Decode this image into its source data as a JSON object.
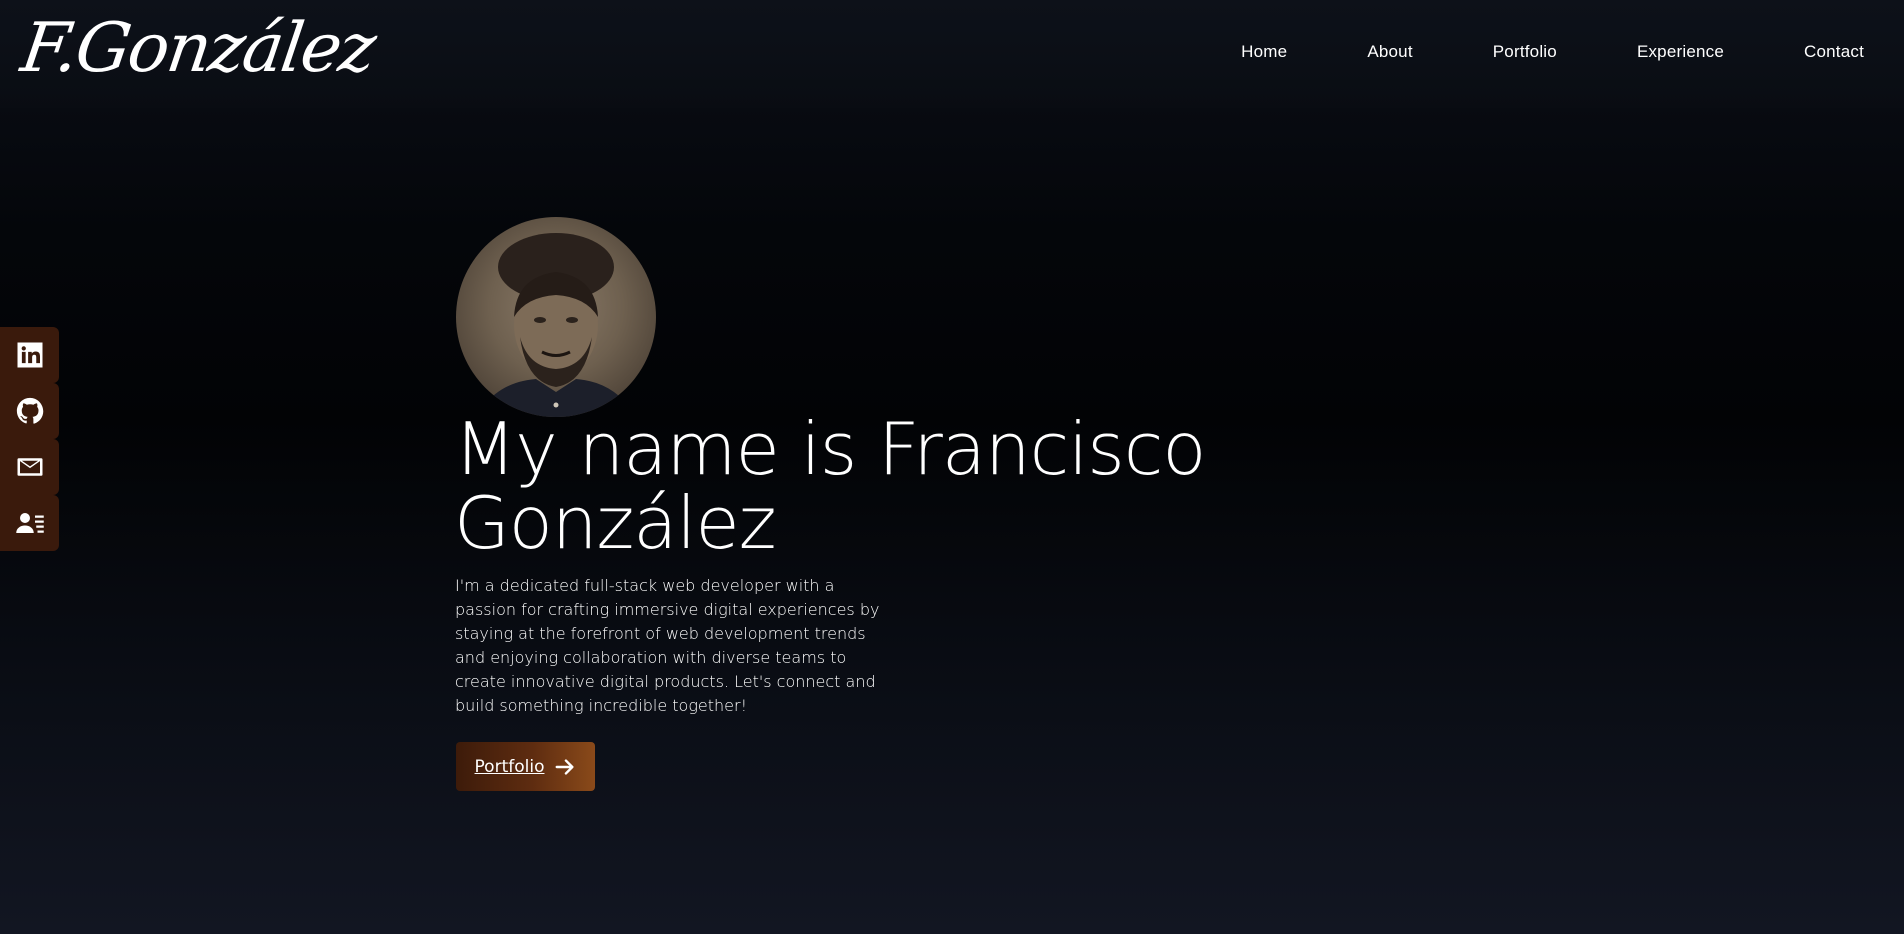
{
  "brand": {
    "logo_text": "F.González"
  },
  "nav": {
    "items": [
      "Home",
      "About",
      "Portfolio",
      "Experience",
      "Contact"
    ]
  },
  "social": {
    "items": [
      {
        "icon": "linkedin-icon"
      },
      {
        "icon": "github-icon"
      },
      {
        "icon": "mail-icon"
      },
      {
        "icon": "resume-icon"
      }
    ]
  },
  "hero": {
    "headline": "My name is Francisco González",
    "bio": "I'm a dedicated full-stack web developer with a passion for crafting immersive digital experiences by staying at the forefront of web development trends and enjoying collaboration with diverse teams to create innovative digital products. Let's connect and build something incredible together!",
    "cta_label": "Portfolio"
  },
  "colors": {
    "accent_dark": "#3d1b0a",
    "accent_light": "#8a4a1a",
    "social_bg": "#3a1a0c"
  }
}
